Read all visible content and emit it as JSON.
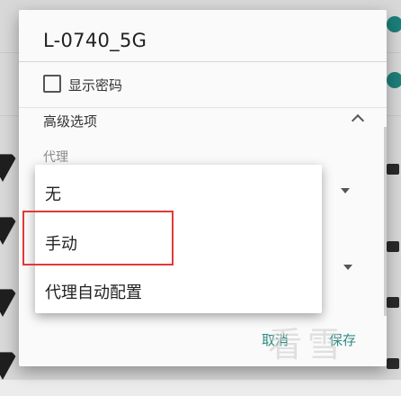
{
  "dialog": {
    "title": "L-0740_5G",
    "show_password_label": "显示密码",
    "advanced_options_label": "高级选项",
    "proxy_label": "代理",
    "cancel_label": "取消",
    "save_label": "保存"
  },
  "proxy_menu": {
    "items": [
      "无",
      "手动",
      "代理自动配置"
    ],
    "highlighted_item": "手动"
  },
  "colors": {
    "accent": "#2d8c84",
    "highlight_border": "#e0393b"
  }
}
